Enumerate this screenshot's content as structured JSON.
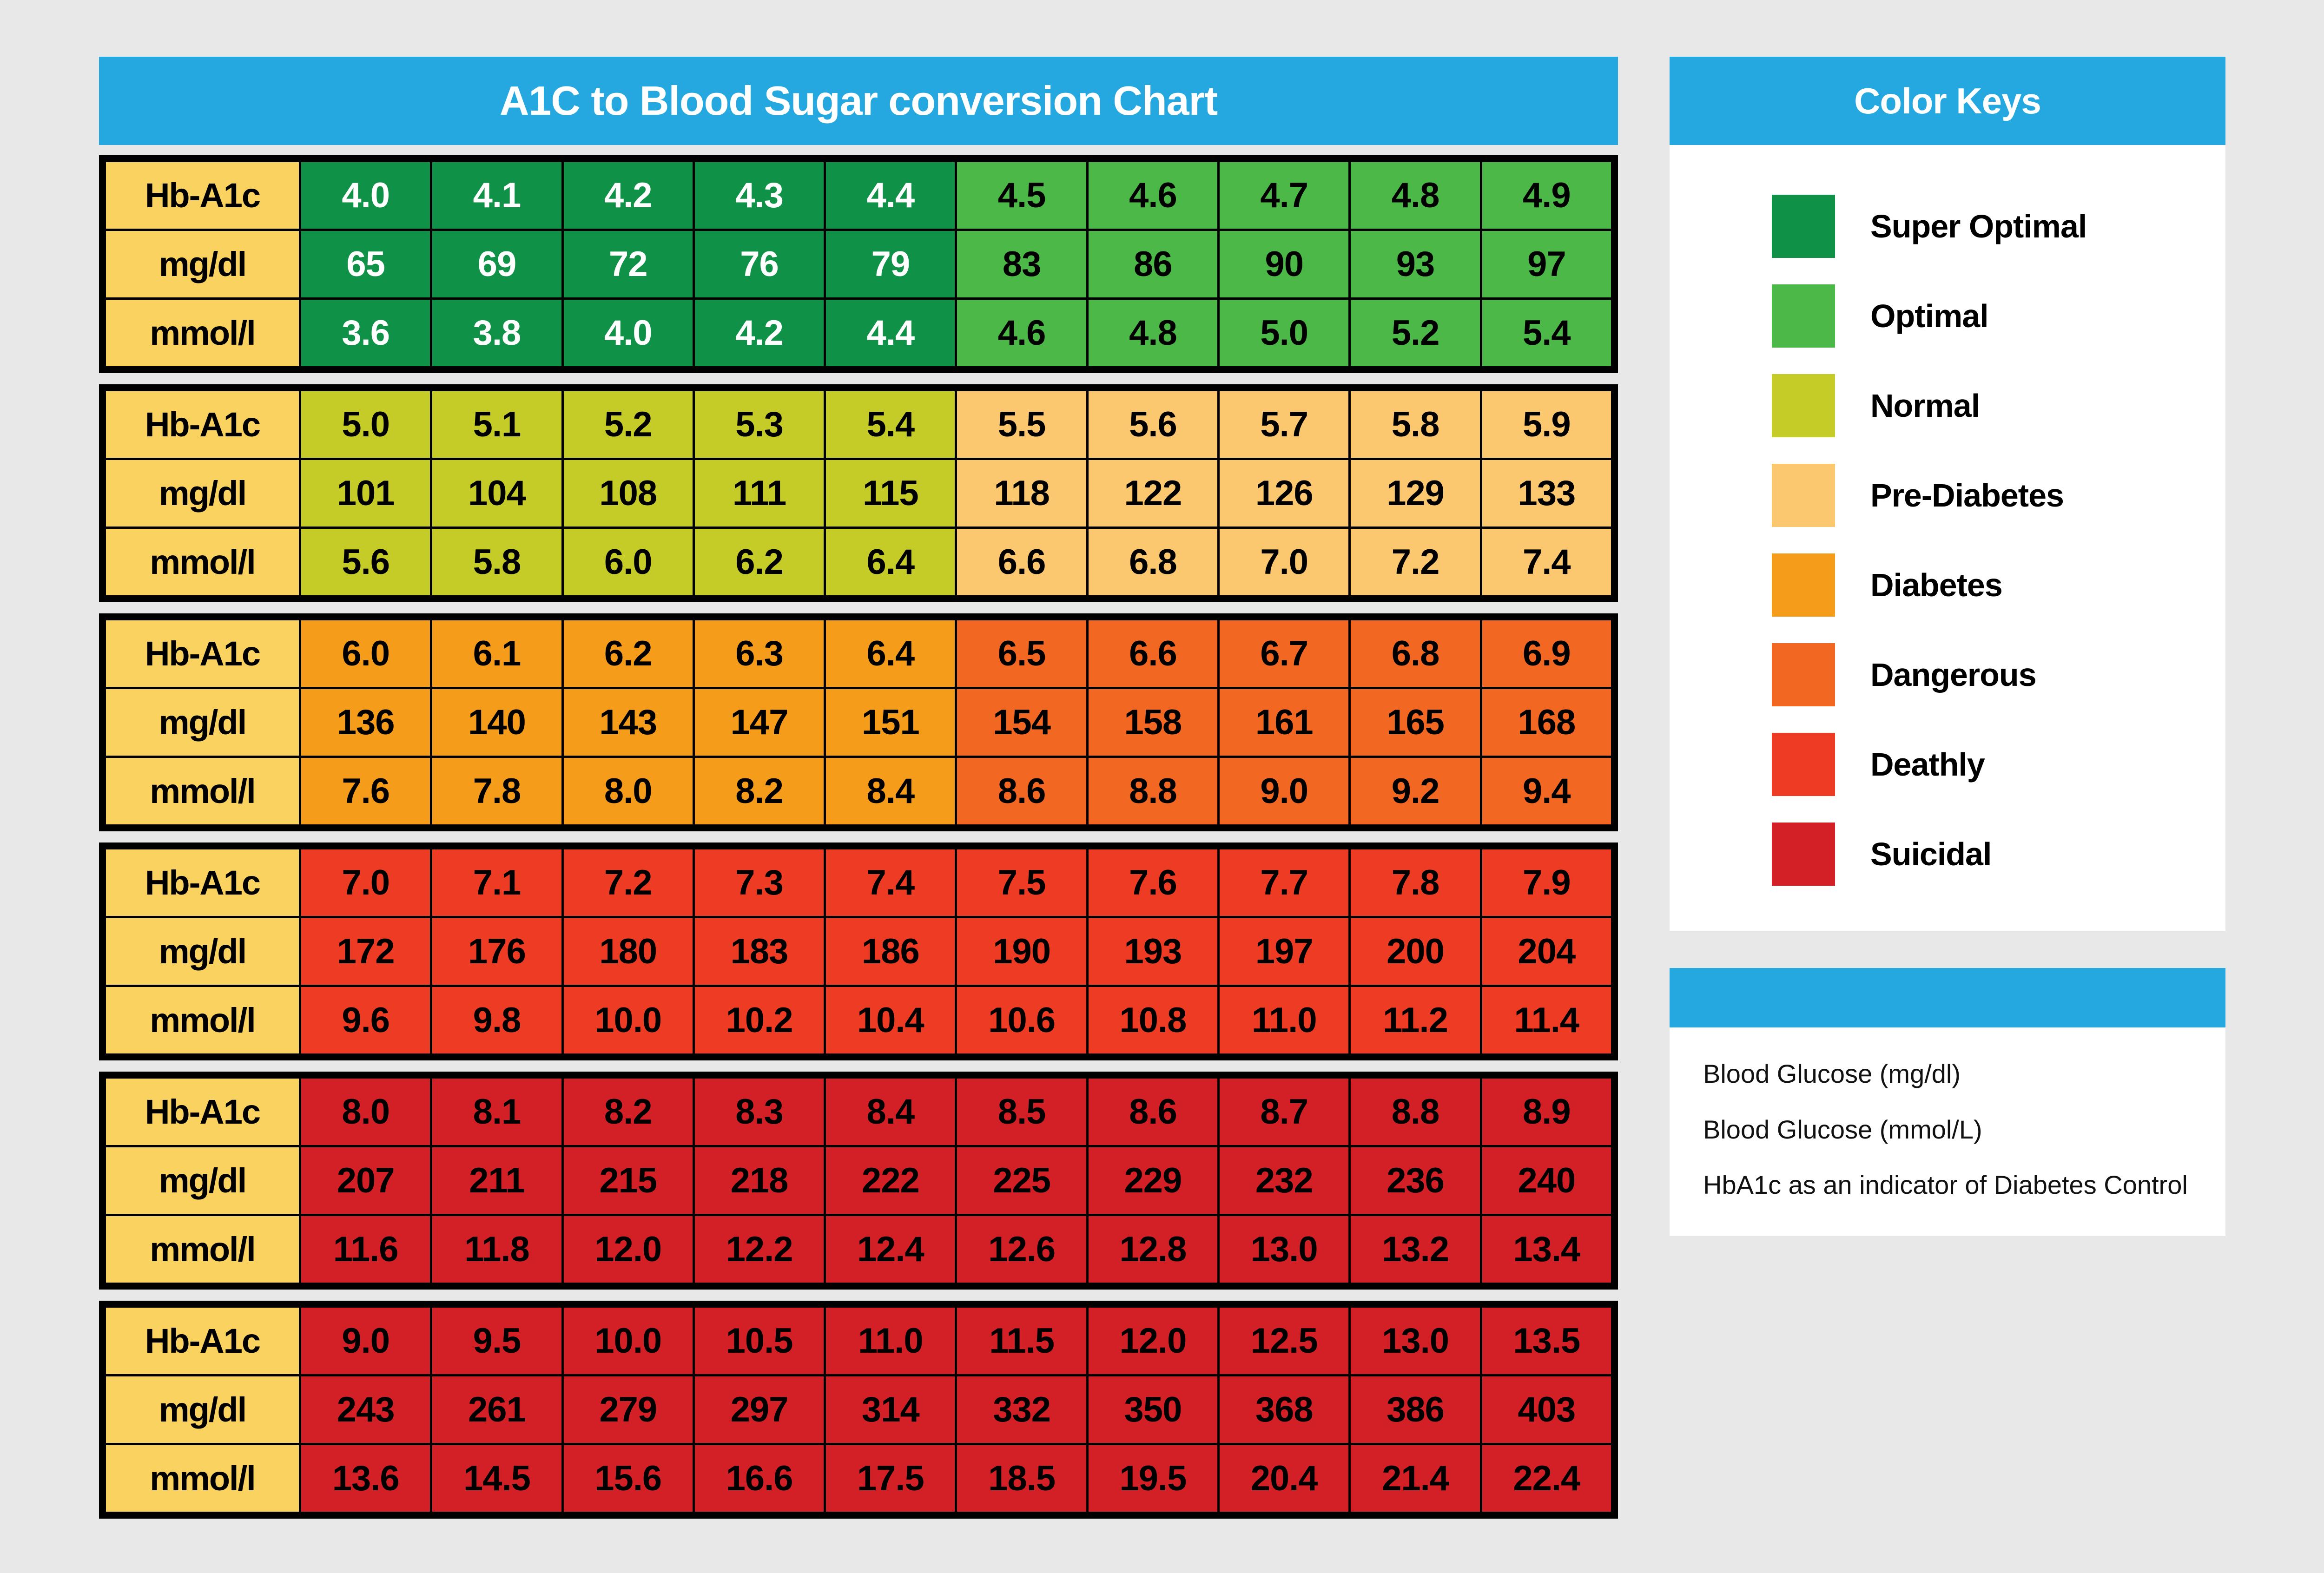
{
  "header": {
    "chart_title": "A1C to Blood Sugar conversion Chart",
    "keys_title": "Color Keys"
  },
  "row_labels": {
    "a1c": "Hb-A1c",
    "mgdl": "mg/dl",
    "mmol": "mmol/l"
  },
  "legend": {
    "items": [
      {
        "label": "Super Optimal",
        "color": "#0f9247",
        "key": "superoptimal"
      },
      {
        "label": "Optimal",
        "color": "#4cb848",
        "key": "optimal"
      },
      {
        "label": "Normal",
        "color": "#c6cc27",
        "key": "normal"
      },
      {
        "label": "Pre-Diabetes",
        "color": "#fbc870",
        "key": "prediabetes"
      },
      {
        "label": "Diabetes",
        "color": "#f59c1b",
        "key": "diabetes"
      },
      {
        "label": "Dangerous",
        "color": "#f26722",
        "key": "dangerous"
      },
      {
        "label": "Deathly",
        "color": "#ee3b24",
        "key": "deathly"
      },
      {
        "label": "Suicidal",
        "color": "#d32027",
        "key": "suicidal"
      }
    ]
  },
  "info": {
    "lines": [
      "Blood Glucose (mg/dl)",
      "Blood Glucose (mmol/L)",
      "HbA1c as an indicator of Diabetes Control"
    ]
  },
  "chart_data": {
    "type": "table",
    "title": "A1C to Blood Sugar conversion Chart",
    "row_headers": [
      "Hb-A1c",
      "mg/dl",
      "mmol/l"
    ],
    "legend_entries": [
      "Super Optimal",
      "Optimal",
      "Normal",
      "Pre-Diabetes",
      "Diabetes",
      "Dangerous",
      "Deathly",
      "Suicidal"
    ],
    "blocks": [
      {
        "index": 0,
        "a1c": [
          "4.0",
          "4.1",
          "4.2",
          "4.3",
          "4.4",
          "4.5",
          "4.6",
          "4.7",
          "4.8",
          "4.9"
        ],
        "mgdl": [
          "65",
          "69",
          "72",
          "76",
          "79",
          "83",
          "86",
          "90",
          "93",
          "97"
        ],
        "mmol": [
          "3.6",
          "3.8",
          "4.0",
          "4.2",
          "4.4",
          "4.6",
          "4.8",
          "5.0",
          "5.2",
          "5.4"
        ],
        "cell_classes": [
          "superoptimal",
          "superoptimal",
          "superoptimal",
          "superoptimal",
          "superoptimal",
          "optimal",
          "optimal",
          "optimal",
          "optimal",
          "optimal"
        ]
      },
      {
        "index": 1,
        "a1c": [
          "5.0",
          "5.1",
          "5.2",
          "5.3",
          "5.4",
          "5.5",
          "5.6",
          "5.7",
          "5.8",
          "5.9"
        ],
        "mgdl": [
          "101",
          "104",
          "108",
          "111",
          "115",
          "118",
          "122",
          "126",
          "129",
          "133"
        ],
        "mmol": [
          "5.6",
          "5.8",
          "6.0",
          "6.2",
          "6.4",
          "6.6",
          "6.8",
          "7.0",
          "7.2",
          "7.4"
        ],
        "cell_classes": [
          "normal",
          "normal",
          "normal",
          "normal",
          "normal",
          "prediabetes",
          "prediabetes",
          "prediabetes",
          "prediabetes",
          "prediabetes"
        ]
      },
      {
        "index": 2,
        "a1c": [
          "6.0",
          "6.1",
          "6.2",
          "6.3",
          "6.4",
          "6.5",
          "6.6",
          "6.7",
          "6.8",
          "6.9"
        ],
        "mgdl": [
          "136",
          "140",
          "143",
          "147",
          "151",
          "154",
          "158",
          "161",
          "165",
          "168"
        ],
        "mmol": [
          "7.6",
          "7.8",
          "8.0",
          "8.2",
          "8.4",
          "8.6",
          "8.8",
          "9.0",
          "9.2",
          "9.4"
        ],
        "cell_classes": [
          "diabetes",
          "diabetes",
          "diabetes",
          "diabetes",
          "diabetes",
          "dangerous",
          "dangerous",
          "dangerous",
          "dangerous",
          "dangerous"
        ]
      },
      {
        "index": 3,
        "a1c": [
          "7.0",
          "7.1",
          "7.2",
          "7.3",
          "7.4",
          "7.5",
          "7.6",
          "7.7",
          "7.8",
          "7.9"
        ],
        "mgdl": [
          "172",
          "176",
          "180",
          "183",
          "186",
          "190",
          "193",
          "197",
          "200",
          "204"
        ],
        "mmol": [
          "9.6",
          "9.8",
          "10.0",
          "10.2",
          "10.4",
          "10.6",
          "10.8",
          "11.0",
          "11.2",
          "11.4"
        ],
        "cell_classes": [
          "deathly",
          "deathly",
          "deathly",
          "deathly",
          "deathly",
          "dangerous2",
          "dangerous2",
          "dangerous2",
          "dangerous2",
          "dangerous2"
        ]
      },
      {
        "index": 4,
        "a1c": [
          "8.0",
          "8.1",
          "8.2",
          "8.3",
          "8.4",
          "8.5",
          "8.6",
          "8.7",
          "8.8",
          "8.9"
        ],
        "mgdl": [
          "207",
          "211",
          "215",
          "218",
          "222",
          "225",
          "229",
          "232",
          "236",
          "240"
        ],
        "mmol": [
          "11.6",
          "11.8",
          "12.0",
          "12.2",
          "12.4",
          "12.6",
          "12.8",
          "13.0",
          "13.2",
          "13.4"
        ],
        "cell_classes": [
          "suicidal",
          "suicidal",
          "suicidal",
          "suicidal",
          "suicidal",
          "suicidal",
          "suicidal",
          "suicidal",
          "suicidal",
          "suicidal"
        ]
      },
      {
        "index": 5,
        "a1c": [
          "9.0",
          "9.5",
          "10.0",
          "10.5",
          "11.0",
          "11.5",
          "12.0",
          "12.5",
          "13.0",
          "13.5"
        ],
        "mgdl": [
          "243",
          "261",
          "279",
          "297",
          "314",
          "332",
          "350",
          "368",
          "386",
          "403"
        ],
        "mmol": [
          "13.6",
          "14.5",
          "15.6",
          "16.6",
          "17.5",
          "18.5",
          "19.5",
          "20.4",
          "21.4",
          "22.4"
        ],
        "cell_classes": [
          "suicidal",
          "suicidal",
          "suicidal",
          "suicidal",
          "suicidal",
          "suicidal",
          "suicidal",
          "suicidal",
          "suicidal",
          "suicidal"
        ]
      }
    ]
  }
}
